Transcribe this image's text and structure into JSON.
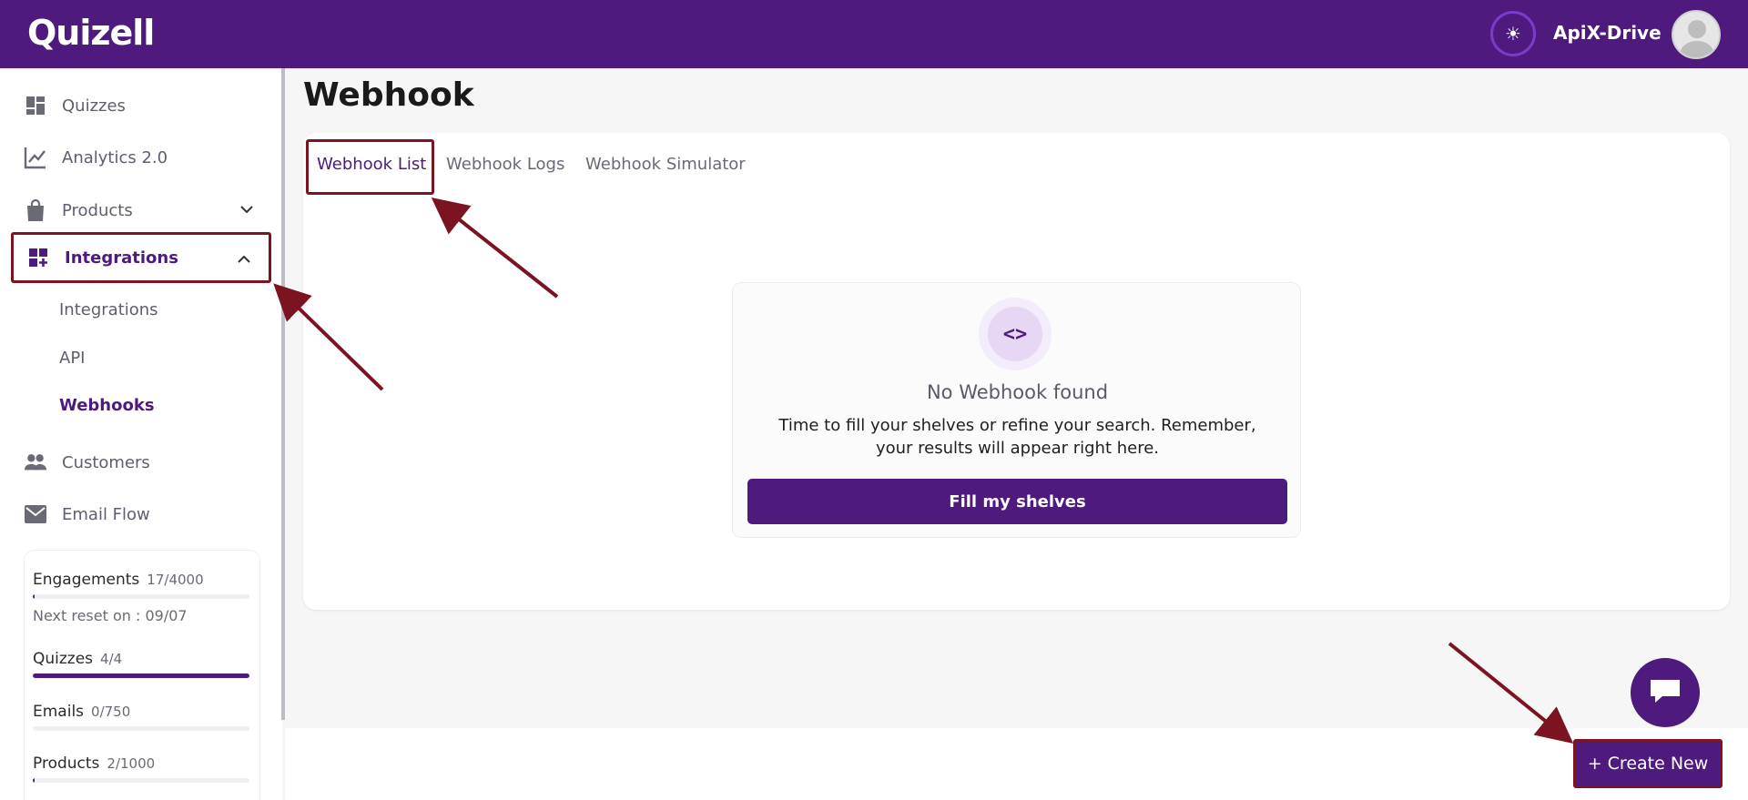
{
  "header": {
    "logo_text": "Quizell",
    "account_name": "ApiX-Drive"
  },
  "sidebar": {
    "items": [
      {
        "label": "Quizzes",
        "icon": "dashboard-icon"
      },
      {
        "label": "Analytics 2.0",
        "icon": "chart-line-icon"
      },
      {
        "label": "Products",
        "icon": "shopping-bag-icon"
      },
      {
        "label": "Integrations",
        "icon": "widgets-add-icon"
      },
      {
        "label": "Customers",
        "icon": "people-icon"
      },
      {
        "label": "Email Flow",
        "icon": "mail-icon"
      }
    ],
    "sub_items": [
      {
        "label": "Integrations"
      },
      {
        "label": "API"
      },
      {
        "label": "Webhooks"
      }
    ],
    "usage": {
      "engagements": {
        "label": "Engagements",
        "count": "17/4000",
        "fraction": 0.00425
      },
      "reset_text": "Next reset on : 09/07",
      "quizzes": {
        "label": "Quizzes",
        "count": "4/4",
        "fraction": 1.0
      },
      "emails": {
        "label": "Emails",
        "count": "0/750",
        "fraction": 0.0
      },
      "products": {
        "label": "Products",
        "count": "2/1000",
        "fraction": 0.002
      }
    }
  },
  "main": {
    "title": "Webhook",
    "tabs": [
      {
        "label": "Webhook List"
      },
      {
        "label": "Webhook Logs"
      },
      {
        "label": "Webhook Simulator"
      }
    ],
    "empty_state": {
      "icon": "code-brackets-icon",
      "icon_glyph": "<>",
      "title": "No Webhook found",
      "description": "Time to fill your shelves or refine your search. Remember, your results will appear right here.",
      "button_label": "Fill my shelves"
    },
    "create_button": "+ Create New"
  },
  "colors": {
    "brand": "#4e1a7d",
    "annotation": "#7b1420"
  }
}
